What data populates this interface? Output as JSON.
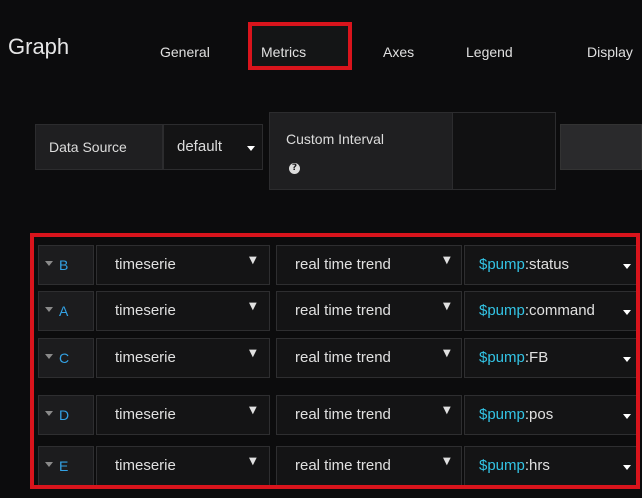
{
  "panel": {
    "title": "Graph",
    "tabs": [
      {
        "label": "General"
      },
      {
        "label": "Metrics"
      },
      {
        "label": "Axes"
      },
      {
        "label": "Legend"
      },
      {
        "label": "Display"
      }
    ],
    "active_tab": "Metrics"
  },
  "datasource": {
    "label": "Data Source",
    "value": "default",
    "custom_interval_label": "Custom Interval",
    "help_icon": "question-circle-icon"
  },
  "queries": [
    {
      "letter": "B",
      "function": "timeserie",
      "mode": "real time trend",
      "metric_var": "$pump",
      "metric_field": ":status"
    },
    {
      "letter": "A",
      "function": "timeserie",
      "mode": "real time trend",
      "metric_var": "$pump",
      "metric_field": ":command"
    },
    {
      "letter": "C",
      "function": "timeserie",
      "mode": "real time trend",
      "metric_var": "$pump",
      "metric_field": ":FB"
    },
    {
      "letter": "D",
      "function": "timeserie",
      "mode": "real time trend",
      "metric_var": "$pump",
      "metric_field": ":pos"
    },
    {
      "letter": "E",
      "function": "timeserie",
      "mode": "real time trend",
      "metric_var": "$pump",
      "metric_field": ":hrs"
    }
  ],
  "colors": {
    "background": "#0c0c0d",
    "highlight": "#d9141c",
    "letter": "#33a2e5",
    "variable": "#33c4e5"
  }
}
